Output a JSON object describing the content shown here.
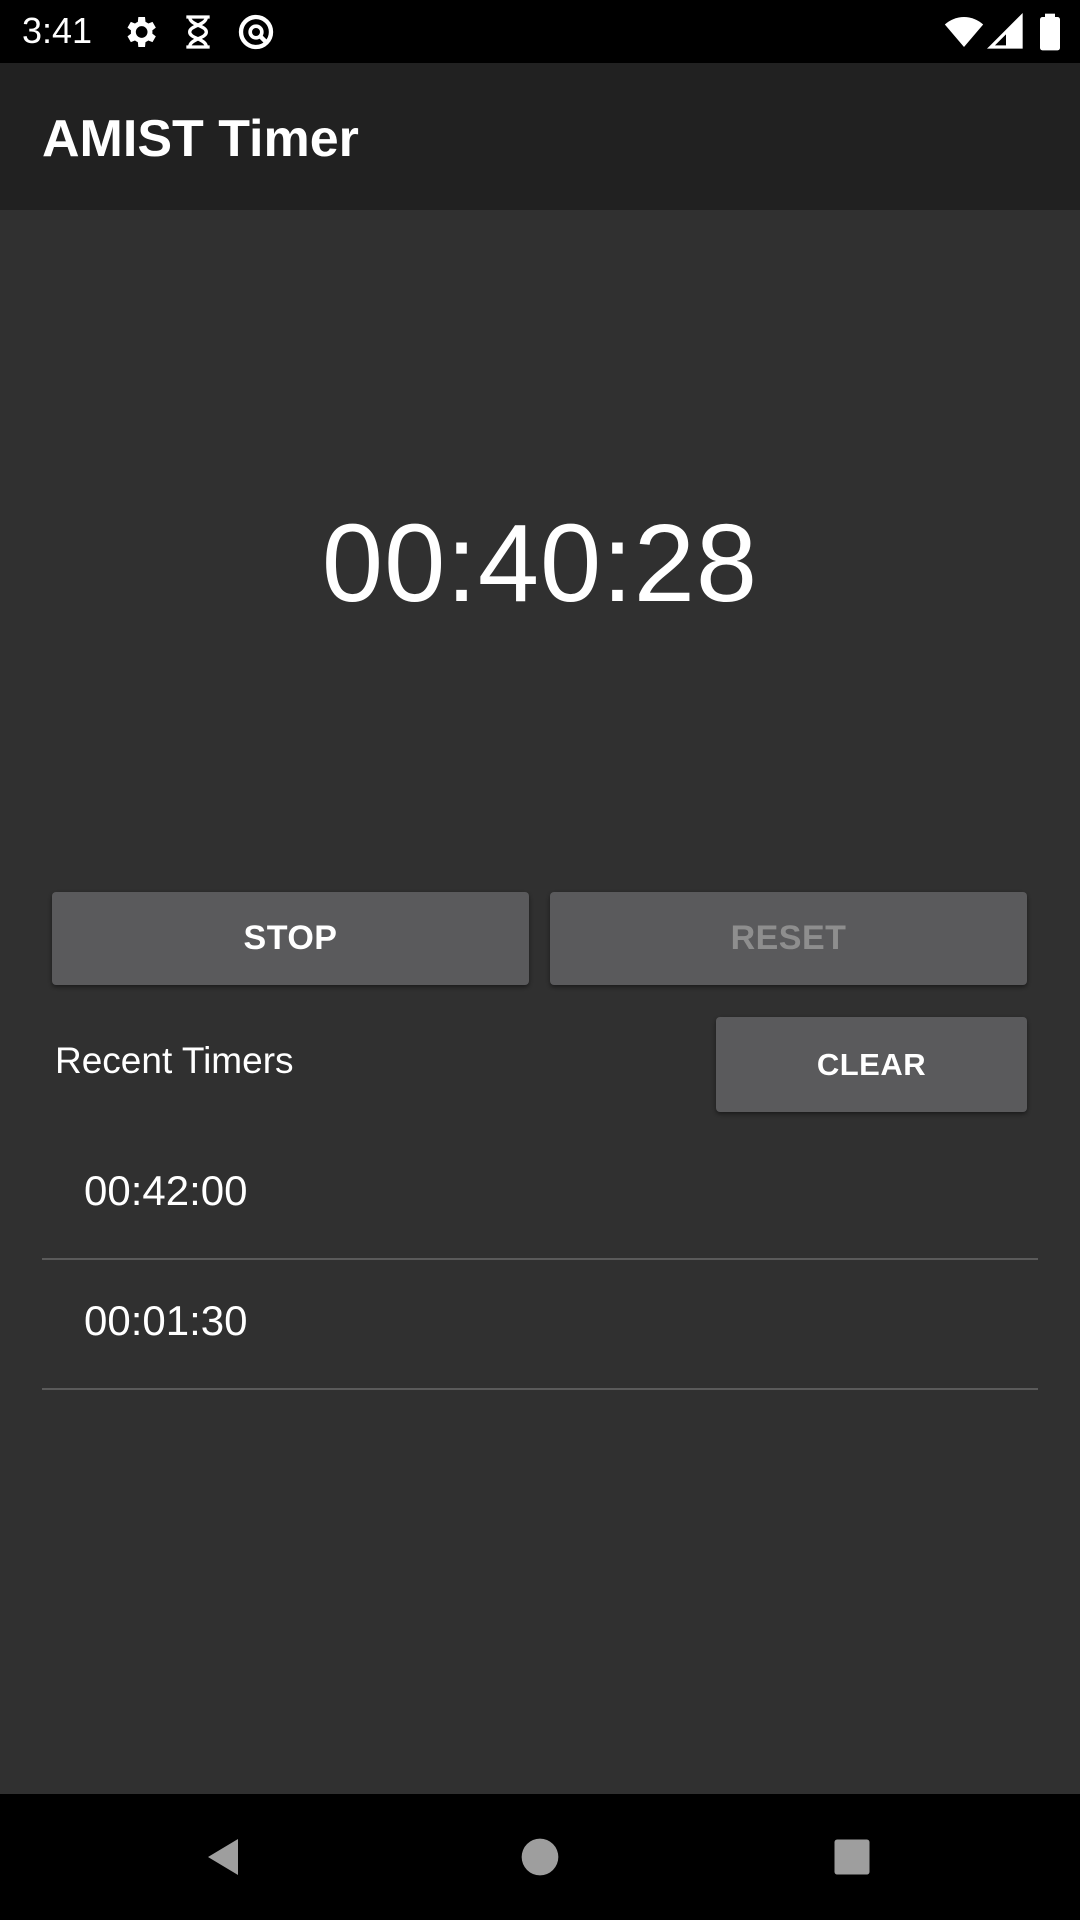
{
  "status_bar": {
    "time": "3:41",
    "left_icons": [
      "gear-icon",
      "hourglass-icon",
      "no-entry-icon"
    ],
    "right_icons": [
      "wifi-icon",
      "cell-signal-icon",
      "battery-icon"
    ]
  },
  "app_bar": {
    "title": "AMIST Timer"
  },
  "timer": {
    "display": "00:40:28"
  },
  "controls": {
    "stop_label": "STOP",
    "reset_label": "RESET",
    "reset_enabled": false
  },
  "recent": {
    "heading": "Recent Timers",
    "clear_label": "CLEAR",
    "items": [
      {
        "time": "00:42:00"
      },
      {
        "time": "00:01:30"
      }
    ]
  },
  "nav_bar": {
    "icons": [
      "back-icon",
      "home-icon",
      "recents-icon"
    ]
  },
  "colors": {
    "background": "#303030",
    "app_bar": "#212121",
    "button": "#5a5a5c",
    "disabled_text": "#8e8e8e"
  }
}
